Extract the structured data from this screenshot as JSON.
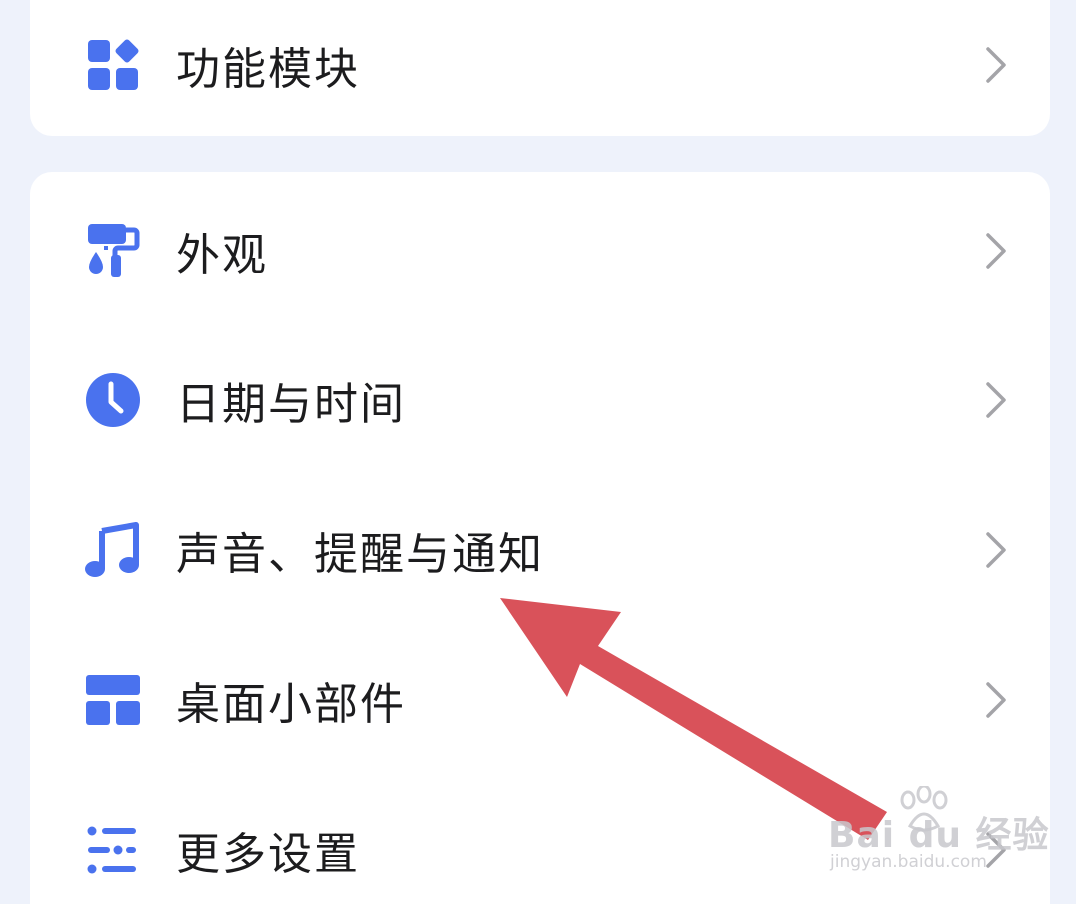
{
  "menu_top": {
    "items": [
      {
        "label": "功能模块",
        "icon": "grid-modules-icon"
      }
    ]
  },
  "menu_main": {
    "items": [
      {
        "label": "外观",
        "icon": "paint-roller-icon"
      },
      {
        "label": "日期与时间",
        "icon": "clock-icon"
      },
      {
        "label": "声音、提醒与通知",
        "icon": "music-note-icon"
      },
      {
        "label": "桌面小部件",
        "icon": "widget-layout-icon"
      },
      {
        "label": "更多设置",
        "icon": "list-settings-icon"
      }
    ]
  },
  "colors": {
    "accent": "#4a72ee",
    "annotation_arrow": "#d9525a",
    "chevron": "#a4a4a8",
    "background": "#eef2fb"
  },
  "watermark": {
    "brand": "Bai du 经验",
    "url": "jingyan.baidu.com"
  }
}
